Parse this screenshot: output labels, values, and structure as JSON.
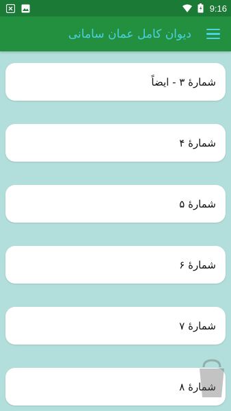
{
  "status_bar": {
    "time": "9:16",
    "left_icons": [
      "x-box-icon",
      "image-icon"
    ],
    "right_icons": [
      "wifi-icon",
      "battery-icon"
    ]
  },
  "app_bar": {
    "title": "دیوان کامل عمان سامانی",
    "menu_icon": "hamburger-menu-icon"
  },
  "list": {
    "items": [
      {
        "label": "شمارهٔ ۳ - ایضاً"
      },
      {
        "label": "شمارهٔ ۴"
      },
      {
        "label": "شمارهٔ ۵"
      },
      {
        "label": "شمارهٔ ۶"
      },
      {
        "label": "شمارهٔ ۷"
      },
      {
        "label": "شمارهٔ ۸"
      }
    ]
  },
  "colors": {
    "status_bar": "#1b7a35",
    "app_bar": "#22903f",
    "accent": "#4dd0e1",
    "background": "#b2dfdb",
    "card": "#ffffff"
  }
}
